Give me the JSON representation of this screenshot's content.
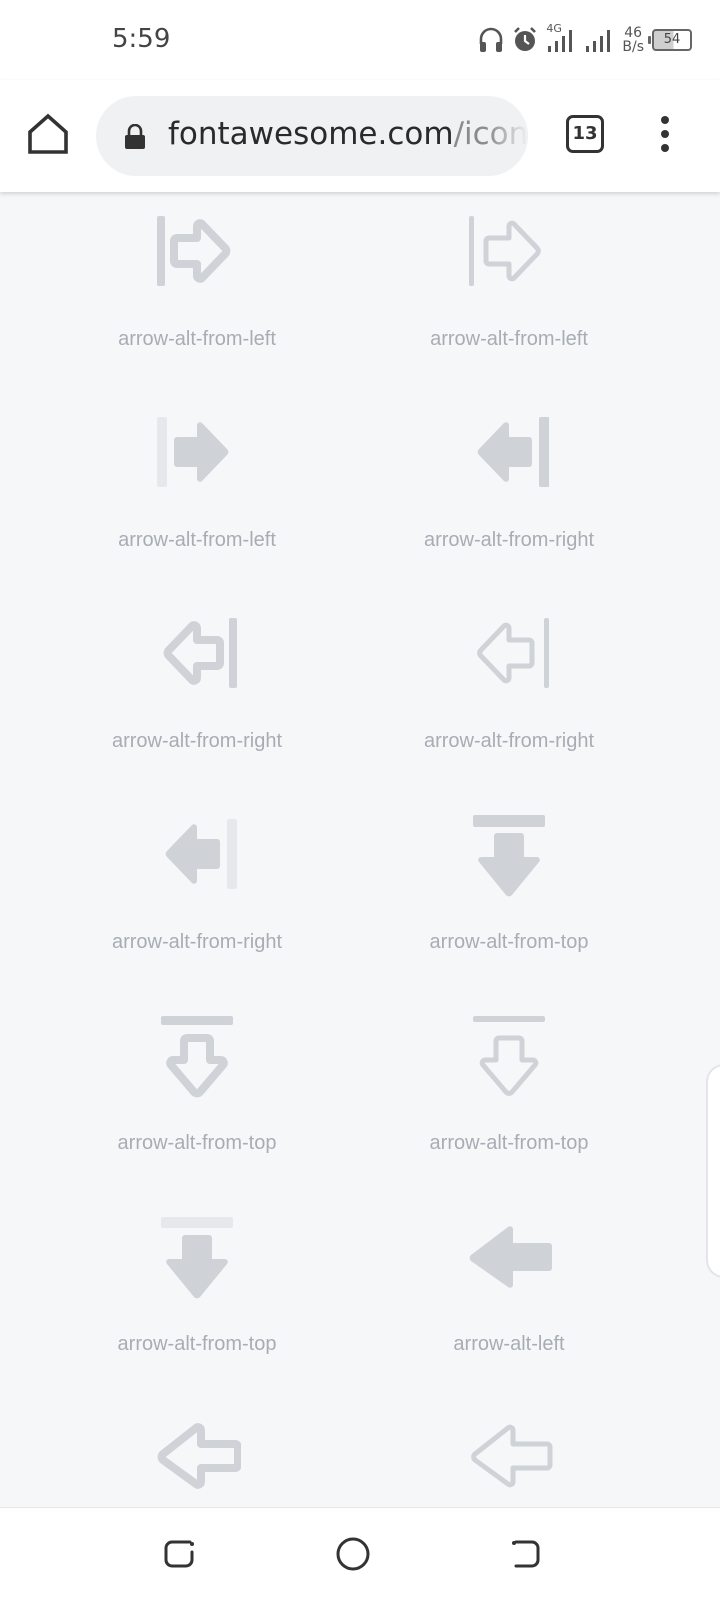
{
  "status": {
    "time": "5:59",
    "network": "4G",
    "speed_value": "46",
    "speed_unit": "B/s",
    "battery": "54"
  },
  "browser": {
    "url_domain": "fontawesome.com",
    "url_path": "/icons",
    "tab_count": "13"
  },
  "icons": [
    {
      "label": "arrow-alt-from-left",
      "icon": "arrow-alt-from-left-duotone-icon"
    },
    {
      "label": "arrow-alt-from-left",
      "icon": "arrow-alt-from-left-light-icon"
    },
    {
      "label": "arrow-alt-from-left",
      "icon": "arrow-alt-from-left-solid-icon"
    },
    {
      "label": "arrow-alt-from-right",
      "icon": "arrow-alt-from-right-solid-icon"
    },
    {
      "label": "arrow-alt-from-right",
      "icon": "arrow-alt-from-right-regular-icon"
    },
    {
      "label": "arrow-alt-from-right",
      "icon": "arrow-alt-from-right-light-icon"
    },
    {
      "label": "arrow-alt-from-right",
      "icon": "arrow-alt-from-right-duotone-icon"
    },
    {
      "label": "arrow-alt-from-top",
      "icon": "arrow-alt-from-top-solid-icon"
    },
    {
      "label": "arrow-alt-from-top",
      "icon": "arrow-alt-from-top-regular-icon"
    },
    {
      "label": "arrow-alt-from-top",
      "icon": "arrow-alt-from-top-light-icon"
    },
    {
      "label": "arrow-alt-from-top",
      "icon": "arrow-alt-from-top-duotone-icon"
    },
    {
      "label": "arrow-alt-left",
      "icon": "arrow-alt-left-solid-icon"
    },
    {
      "label": "",
      "icon": "arrow-alt-left-regular-icon"
    },
    {
      "label": "",
      "icon": "arrow-alt-left-light-icon"
    }
  ],
  "colors": {
    "icon_gray": "#cfd3d8",
    "icon_light": "#e6e8eb",
    "label": "#a8adb4",
    "page_bg": "#f5f7f9"
  }
}
